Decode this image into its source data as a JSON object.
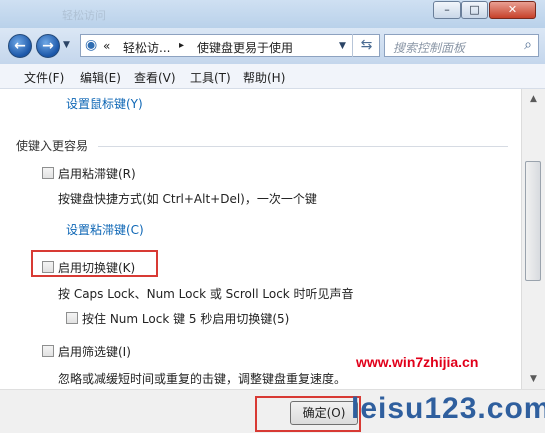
{
  "window": {
    "title": "轻松访问",
    "buttons": {
      "minimize": "–",
      "maximize": "□",
      "close": "✕"
    }
  },
  "nav": {
    "back_icon": "arrow-left-icon",
    "forward_icon": "arrow-right-icon",
    "breadcrumb": [
      "«",
      "轻松访...",
      "▸",
      "使键盘更易于使用"
    ],
    "refresh_icon": "refresh-icon",
    "search_placeholder": "搜索控制面板"
  },
  "menu": [
    "文件(F)",
    "编辑(E)",
    "查看(V)",
    "工具(T)",
    "帮助(H)"
  ],
  "content": {
    "mouse_keys_link": "设置鼠标键(Y)",
    "section_title": "使键入更容易",
    "sticky_checkbox": "启用粘滞键(R)",
    "sticky_desc": "按键盘快捷方式(如 Ctrl+Alt+Del)，一次一个键",
    "sticky_link": "设置粘滞键(C)",
    "toggle_checkbox": "启用切换键(K)",
    "toggle_desc": "按 Caps Lock、Num Lock 或 Scroll Lock 时听见声音",
    "toggle_sub_checkbox": "按住 Num Lock 键 5 秒启用切换键(5)",
    "filter_checkbox": "启用筛选键(I)",
    "filter_desc": "忽略或减缓短时间或重复的击键，调整键盘重复速度。"
  },
  "footer": {
    "ok_label": "确定(O)"
  },
  "watermark": {
    "top": "www.win7zhijia.cn",
    "bottom": "leisu123.com"
  },
  "colors": {
    "link": "#0d66b5",
    "highlight": "#d83a34"
  }
}
